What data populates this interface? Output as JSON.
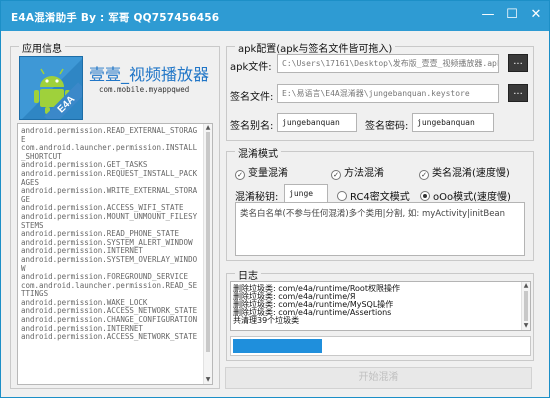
{
  "window": {
    "title": "E4A混淆助手 By : 军哥 QQ757456456",
    "minimize_glyph": "—",
    "maximize_glyph": "☐",
    "close_glyph": "✕",
    "accent_color": "#2e9bd3"
  },
  "app_info": {
    "group_label": "应用信息",
    "icon_name": "android-e4a-icon",
    "icon_text": "E4A",
    "app_name": "壹壹_视频播放器",
    "package": "com.mobile.myappqwed",
    "permissions": [
      "android.permission.READ_EXTERNAL_STORAGE",
      "com.android.launcher.permission.INSTALL_SHORTCUT",
      "android.permission.GET_TASKS",
      "android.permission.REQUEST_INSTALL_PACKAGES",
      "android.permission.WRITE_EXTERNAL_STORAGE",
      "android.permission.ACCESS_WIFI_STATE",
      "android.permission.MOUNT_UNMOUNT_FILESYSTEMS",
      "android.permission.READ_PHONE_STATE",
      "android.permission.SYSTEM_ALERT_WINDOW",
      "android.permission.INTERNET",
      "android.permission.SYSTEM_OVERLAY_WINDOW",
      "android.permission.FOREGROUND_SERVICE",
      "com.android.launcher.permission.READ_SETTINGS",
      "android.permission.WAKE_LOCK",
      "android.permission.ACCESS_NETWORK_STATE",
      "android.permission.CHANGE_CONFIGURATION",
      "android.permission.INTERNET",
      "android.permission.ACCESS_NETWORK_STATE"
    ]
  },
  "apk_config": {
    "group_label": "apk配置(apk与签名文件皆可拖入)",
    "apk_file_label": "apk文件:",
    "apk_file_value": "C:\\Users\\17161\\Desktop\\发布版_壹壹_视频播放器.apk",
    "sign_file_label": "签名文件:",
    "sign_file_value": "E:\\易语言\\E4A混淆器\\jungebanquan.keystore",
    "browse_label": "...",
    "alias_label": "签名别名:",
    "alias_value": "jungebanquan",
    "password_label": "签名密码:",
    "password_value": "jungebanquan"
  },
  "obfuscation": {
    "group_label": "混淆模式",
    "opt_variable": "变量混淆",
    "opt_method": "方法混淆",
    "opt_classname": "类名混淆(速度慢)",
    "check_glyph": "✓",
    "key_label": "混淆秘钥:",
    "key_value": "junge",
    "mode_rc4": "RC4密文模式",
    "mode_ooo": "oOo模式(速度慢)",
    "selected_mode": "oOo",
    "whitelist_text": "类名白名单(不参与任何混淆)多个类用|分割, 如: myActivity|initBean"
  },
  "log": {
    "group_label": "日志",
    "lines": [
      "删除垃圾类: com/e4a/runtime/Root权限操作",
      "删除垃圾类: com/e4a/runtime/Я",
      "删除垃圾类: com/e4a/runtime/MySQL操作",
      "删除垃圾类: com/e4a/runtime/Assertions",
      "共清理39个垃圾类"
    ],
    "progress_fraction": 0.3
  },
  "start_button": {
    "label": "开始混淆"
  }
}
